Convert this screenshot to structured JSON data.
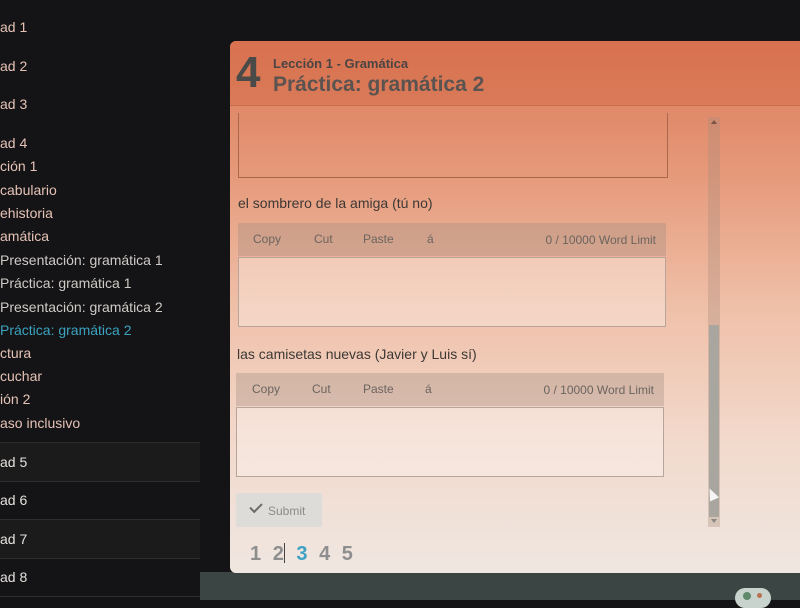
{
  "sidebar": {
    "items": [
      {
        "label": "ad 1",
        "kind": "unit"
      },
      {
        "label": "ad 2",
        "kind": "unit"
      },
      {
        "label": "ad 3",
        "kind": "unit"
      },
      {
        "label": "ad 4",
        "kind": "unit"
      },
      {
        "label": "ción 1",
        "kind": "lesson"
      },
      {
        "label": "cabulario",
        "kind": "section"
      },
      {
        "label": "ehistoria",
        "kind": "section"
      },
      {
        "label": "amática",
        "kind": "section"
      },
      {
        "label": "Presentación: gramática 1",
        "kind": "sub"
      },
      {
        "label": "Práctica: gramática 1",
        "kind": "sub"
      },
      {
        "label": "Presentación: gramática 2",
        "kind": "sub"
      },
      {
        "label": "Práctica: gramática 2",
        "kind": "sub",
        "active": true
      },
      {
        "label": "ctura",
        "kind": "section"
      },
      {
        "label": "cuchar",
        "kind": "section"
      },
      {
        "label": "ión 2",
        "kind": "lesson"
      },
      {
        "label": "aso inclusivo",
        "kind": "section"
      },
      {
        "label": "ad 5",
        "kind": "unit"
      },
      {
        "label": "ad 6",
        "kind": "unit"
      },
      {
        "label": "ad 7",
        "kind": "unit"
      },
      {
        "label": "ad 8",
        "kind": "unit"
      }
    ],
    "active_color": "#3ba3c0"
  },
  "modal": {
    "lesson_number": "4",
    "subtitle": "Lección 1 - Gramática",
    "title": "Práctica: gramática 2",
    "questions": [
      {
        "prompt": "el sombrero de la amiga (tú no)",
        "toolbar": {
          "copy": "Copy",
          "cut": "Cut",
          "paste": "Paste",
          "accent": "á",
          "word_count": "0 /  10000 Word Limit"
        },
        "answer": ""
      },
      {
        "prompt": "las camisetas nuevas (Javier y Luis sí)",
        "toolbar": {
          "copy": "Copy",
          "cut": "Cut",
          "paste": "Paste",
          "accent": "á",
          "word_count": "0 /  10000 Word Limit"
        },
        "answer": ""
      }
    ],
    "submit_label": "Submit",
    "pages": [
      "1",
      "2",
      "3",
      "4",
      "5"
    ],
    "current_page": "3"
  }
}
